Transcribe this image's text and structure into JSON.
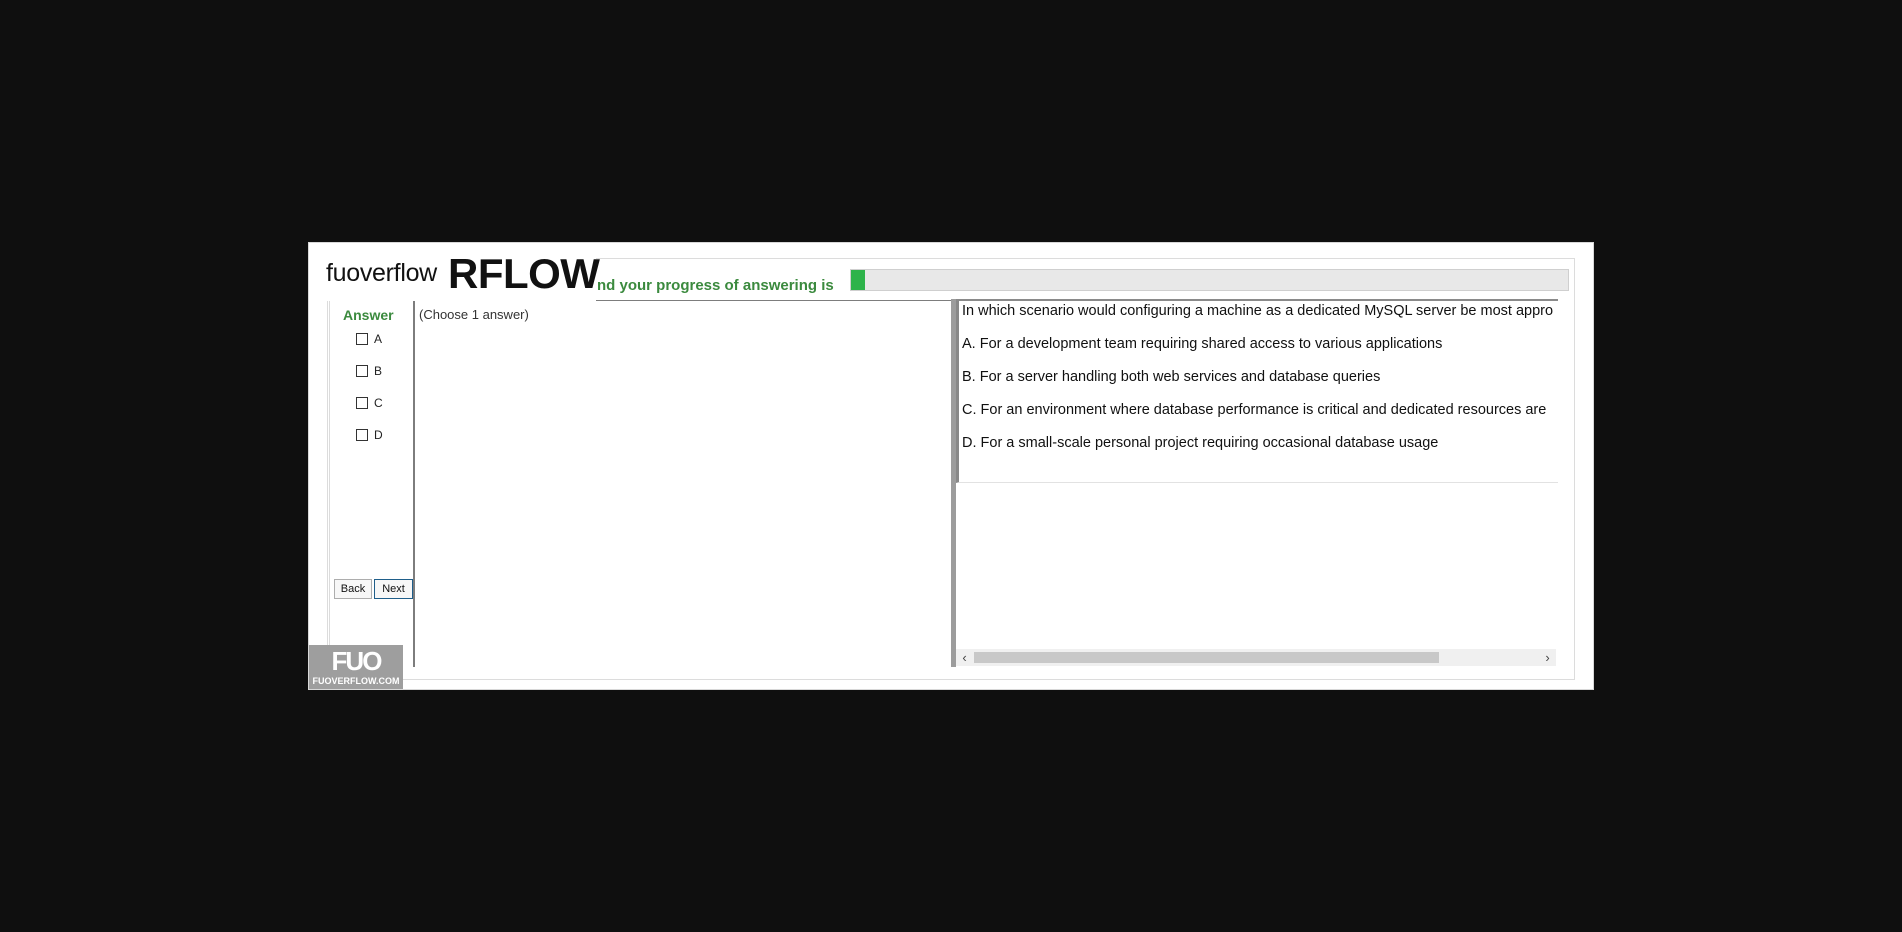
{
  "logo": {
    "small": "fuoverflow",
    "big": "RFLOW"
  },
  "progress": {
    "label": "nd your progress of answering is",
    "fraction": 0.02,
    "color": "#2db34a"
  },
  "answer_panel": {
    "title": "Answer",
    "options": [
      "A",
      "B",
      "C",
      "D"
    ],
    "back_label": "Back",
    "next_label": "Next"
  },
  "middle": {
    "hint": "(Choose 1 answer)"
  },
  "question": {
    "text": "In which scenario would configuring a machine as a dedicated MySQL server be most appro",
    "choices": [
      "A.  For a development team requiring shared access to various applications",
      "B.  For a server handling both web services and database queries",
      "C.  For an environment where database performance is critical and dedicated resources are",
      "D.  For a small-scale personal project requiring occasional database usage"
    ]
  },
  "scrollbar": {
    "left_icon": "‹",
    "right_icon": "›"
  },
  "watermark": {
    "mark": "FUO",
    "domain": "FUOVERFLOW.COM"
  },
  "colors": {
    "accent_green": "#3b8a3e",
    "background": "#0f0f0f"
  }
}
